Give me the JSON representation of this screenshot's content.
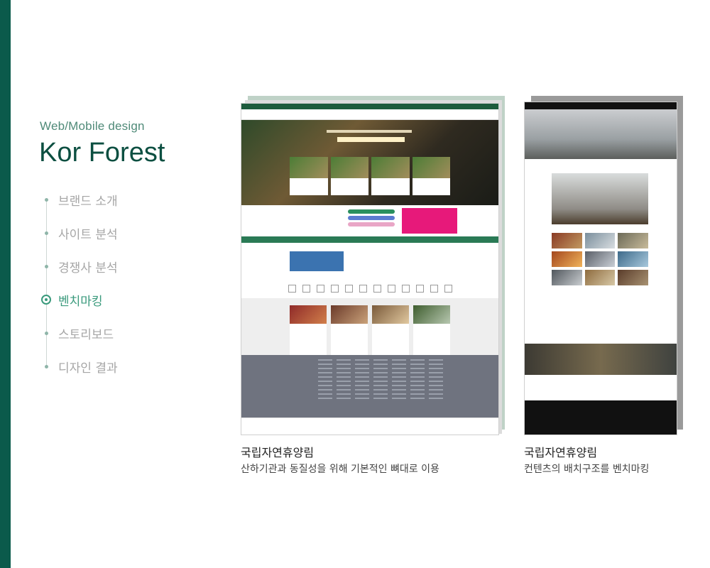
{
  "page": {
    "subtitle": "Web/Mobile design",
    "title": "Kor Forest"
  },
  "nav": {
    "items": [
      {
        "label": "브랜드 소개",
        "active": false
      },
      {
        "label": "사이트 분석",
        "active": false
      },
      {
        "label": "경쟁사 분석",
        "active": false
      },
      {
        "label": "벤치마킹",
        "active": true
      },
      {
        "label": "스토리보드",
        "active": false
      },
      {
        "label": "디자인 결과",
        "active": false
      }
    ]
  },
  "benchmarks": [
    {
      "title": "국립자연휴양림",
      "description": "산하기관과 동질성을 위해 기본적인 뼈대로 이용"
    },
    {
      "title": "국립자연휴양림",
      "description": "컨텐츠의 배치구조를 벤치마킹"
    }
  ],
  "colors": {
    "accent": "#0b5a4b",
    "active_nav": "#3a9a7c",
    "inactive_nav": "#a6a6a6"
  }
}
